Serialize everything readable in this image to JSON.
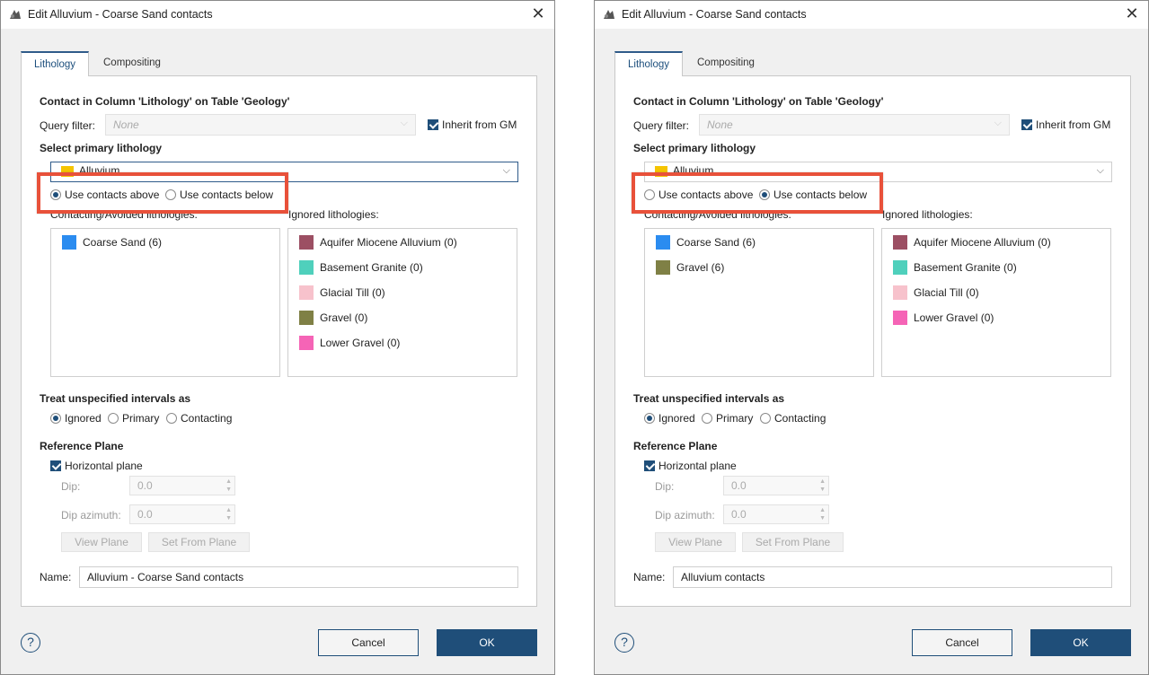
{
  "dialogs": [
    {
      "title": "Edit Alluvium - Coarse Sand contacts",
      "close": "✕",
      "tabs": [
        "Lithology",
        "Compositing"
      ],
      "section_title": "Contact in Column 'Lithology' on Table 'Geology'",
      "query_filter_label": "Query filter:",
      "query_filter_value": "None",
      "inherit_label": "Inherit from GM",
      "select_primary_label": "Select primary lithology",
      "primary_lithology": "Alluvium",
      "primary_color": "#f5c400",
      "contact_above": "Use contacts above",
      "contact_below": "Use contacts below",
      "contact_mode": "above",
      "contacting_label": "Contacting/Avoided lithologies:",
      "ignored_label": "Ignored lithologies:",
      "contacting": [
        {
          "label": "Coarse Sand (6)",
          "color": "#2b8cf0"
        }
      ],
      "ignored": [
        {
          "label": "Aquifer Miocene Alluvium (0)",
          "color": "#9c4f63"
        },
        {
          "label": "Basement Granite (0)",
          "color": "#4fd0bc"
        },
        {
          "label": "Glacial Till (0)",
          "color": "#f7c2cc"
        },
        {
          "label": "Gravel (0)",
          "color": "#7f8045"
        },
        {
          "label": "Lower Gravel (0)",
          "color": "#f564b6"
        }
      ],
      "treat_label": "Treat unspecified intervals as",
      "treat_options": [
        "Ignored",
        "Primary",
        "Contacting"
      ],
      "reference_plane_label": "Reference Plane",
      "horizontal_plane": "Horizontal plane",
      "dip_label": "Dip:",
      "dip_value": "0.0",
      "dip_azimuth_label": "Dip azimuth:",
      "dip_azimuth_value": "0.0",
      "view_plane": "View Plane",
      "set_from_plane": "Set From Plane",
      "name_label": "Name:",
      "name_value": "Alluvium - Coarse Sand contacts",
      "help": "?",
      "cancel": "Cancel",
      "ok": "OK"
    },
    {
      "title": "Edit Alluvium - Coarse Sand contacts",
      "close": "✕",
      "tabs": [
        "Lithology",
        "Compositing"
      ],
      "section_title": "Contact in Column 'Lithology' on Table 'Geology'",
      "query_filter_label": "Query filter:",
      "query_filter_value": "None",
      "inherit_label": "Inherit from GM",
      "select_primary_label": "Select primary lithology",
      "primary_lithology": "Alluvium",
      "primary_color": "#f5c400",
      "contact_above": "Use contacts above",
      "contact_below": "Use contacts below",
      "contact_mode": "below",
      "contacting_label": "Contacting/Avoided lithologies:",
      "ignored_label": "Ignored lithologies:",
      "contacting": [
        {
          "label": "Coarse Sand (6)",
          "color": "#2b8cf0"
        },
        {
          "label": "Gravel (6)",
          "color": "#7f8045"
        }
      ],
      "ignored": [
        {
          "label": "Aquifer Miocene Alluvium (0)",
          "color": "#9c4f63"
        },
        {
          "label": "Basement Granite (0)",
          "color": "#4fd0bc"
        },
        {
          "label": "Glacial Till (0)",
          "color": "#f7c2cc"
        },
        {
          "label": "Lower Gravel (0)",
          "color": "#f564b6"
        }
      ],
      "treat_label": "Treat unspecified intervals as",
      "treat_options": [
        "Ignored",
        "Primary",
        "Contacting"
      ],
      "reference_plane_label": "Reference Plane",
      "horizontal_plane": "Horizontal plane",
      "dip_label": "Dip:",
      "dip_value": "0.0",
      "dip_azimuth_label": "Dip azimuth:",
      "dip_azimuth_value": "0.0",
      "view_plane": "View Plane",
      "set_from_plane": "Set From Plane",
      "name_label": "Name:",
      "name_value": "Alluvium contacts",
      "help": "?",
      "cancel": "Cancel",
      "ok": "OK"
    }
  ],
  "colors": {
    "accent": "#1f4e79",
    "highlight": "#e8513a"
  }
}
